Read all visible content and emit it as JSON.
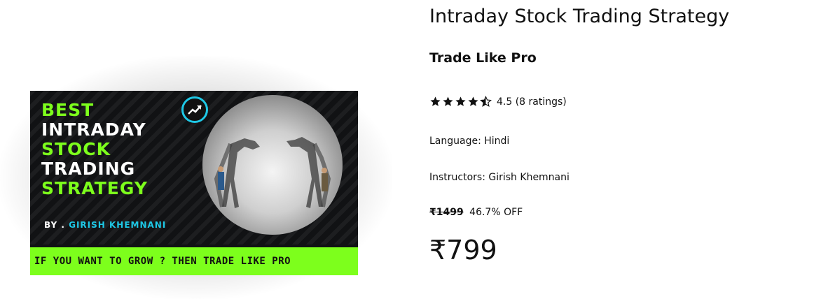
{
  "thumbnail": {
    "headline": [
      "BEST",
      "INTRADAY",
      "STOCK",
      "TRADING",
      "STRATEGY"
    ],
    "by_prefix": "BY .",
    "by_name": "GIRISH KHEMNANI",
    "banner": "IF YOU WANT TO GROW ? THEN TRADE LIKE PRO",
    "accent_color": "#7dff1c",
    "name_color": "#1ec8e6",
    "logo_icon": "chart-arrow-icon"
  },
  "course": {
    "title": "Intraday Stock Trading Strategy",
    "subtitle": "Trade Like Pro",
    "rating_value": 4.5,
    "rating_text": "4.5 (8 ratings)",
    "language_label": "Language: Hindi",
    "instructors_label": "Instructors: Girish Khemnani",
    "original_price": "₹1499",
    "discount": "46.7% OFF",
    "price": "₹799"
  }
}
